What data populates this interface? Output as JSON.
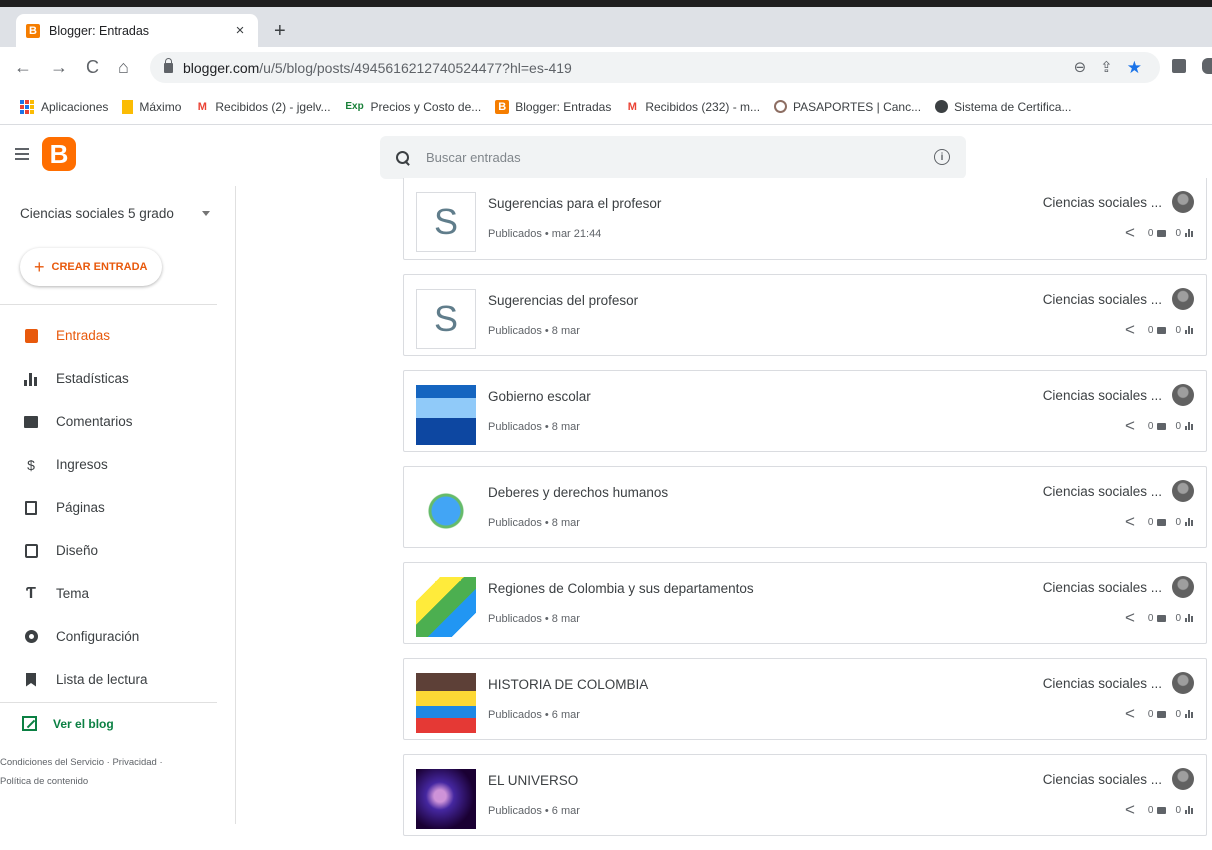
{
  "browser": {
    "tab_title": "Blogger: Entradas",
    "tab_close": "×",
    "new_tab": "+",
    "url_host": "blogger.com",
    "url_path": "/u/5/blog/posts/4945616212740524477?hl=es-419",
    "bookmarks": [
      {
        "label": "Aplicaciones",
        "icon": "apps-grid-icon"
      },
      {
        "label": "Máximo",
        "icon": "bookmark-icon",
        "icon_color": "#fbbc04"
      },
      {
        "label": "Recibidos (2) - jgelv...",
        "icon": "gmail-icon",
        "icon_text": "M"
      },
      {
        "label": "Precios y Costo de...",
        "icon": "exp-icon",
        "icon_text": "Exp"
      },
      {
        "label": "Blogger: Entradas",
        "icon": "blogger-icon",
        "icon_text": "B"
      },
      {
        "label": "Recibidos (232) - m...",
        "icon": "gmail-icon",
        "icon_text": "M"
      },
      {
        "label": "PASAPORTES | Canc...",
        "icon": "seal-icon"
      },
      {
        "label": "Sistema de Certifica...",
        "icon": "globe-icon"
      }
    ]
  },
  "header": {
    "logo_letter": "B",
    "search_placeholder": "Buscar entradas",
    "info_symbol": "i"
  },
  "sidebar": {
    "blog_name": "Ciencias sociales 5 grado",
    "create_label": "CREAR ENTRADA",
    "create_plus": "+",
    "items": [
      {
        "label": "Entradas",
        "icon": "posts-icon",
        "active": true
      },
      {
        "label": "Estadísticas",
        "icon": "stats-icon"
      },
      {
        "label": "Comentarios",
        "icon": "comments-icon"
      },
      {
        "label": "Ingresos",
        "icon": "dollar-icon",
        "glyph": "$"
      },
      {
        "label": "Páginas",
        "icon": "pages-icon"
      },
      {
        "label": "Diseño",
        "icon": "layout-icon"
      },
      {
        "label": "Tema",
        "icon": "theme-icon",
        "glyph": "Ƭ"
      },
      {
        "label": "Configuración",
        "icon": "gear-icon"
      },
      {
        "label": "Lista de lectura",
        "icon": "bookmark-icon"
      }
    ],
    "view_blog": "Ver el blog",
    "footer_line1": "Condiciones del Servicio · Privacidad ·",
    "footer_line2": "Política de contenido"
  },
  "posts": [
    {
      "title": "Sugerencias para el profesor",
      "meta": "Publicados • mar 21:44",
      "thumb": "S",
      "blog": "Ciencias sociales ...",
      "shares": "0",
      "comments": "0",
      "views": "0"
    },
    {
      "title": "Sugerencias del profesor",
      "meta": "Publicados • 8 mar",
      "thumb": "S",
      "blog": "Ciencias sociales ...",
      "shares": "0",
      "comments": "0",
      "views": "0"
    },
    {
      "title": "Gobierno escolar",
      "meta": "Publicados • 8 mar",
      "thumb_img": "gobierno",
      "blog": "Ciencias sociales ...",
      "shares": "0",
      "comments": "0",
      "views": "0"
    },
    {
      "title": "Deberes y derechos humanos",
      "meta": "Publicados • 8 mar",
      "thumb_img": "derechos",
      "blog": "Ciencias sociales ...",
      "shares": "0",
      "comments": "0",
      "views": "0"
    },
    {
      "title": "Regiones de Colombia y sus departamentos",
      "meta": "Publicados • 8 mar",
      "thumb_img": "regiones",
      "blog": "Ciencias sociales ...",
      "shares": "0",
      "comments": "0",
      "views": "0"
    },
    {
      "title": "HISTORIA DE COLOMBIA",
      "meta": "Publicados • 6 mar",
      "thumb_img": "historia",
      "blog": "Ciencias sociales ...",
      "shares": "0",
      "comments": "0",
      "views": "0"
    },
    {
      "title": "EL UNIVERSO",
      "meta": "Publicados • 6 mar",
      "thumb_img": "universo",
      "blog": "Ciencias sociales ...",
      "shares": "0",
      "comments": "0",
      "views": "0"
    }
  ],
  "colors": {
    "accent": "#e8590c",
    "logo": "#ff6e00",
    "view_blog": "#0b8043"
  }
}
